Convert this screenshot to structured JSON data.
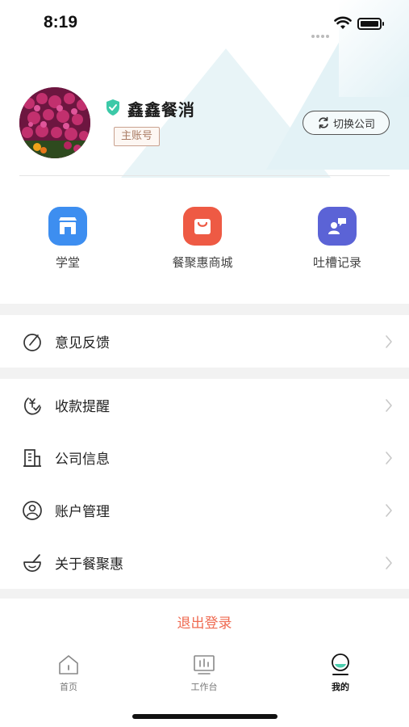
{
  "status_bar": {
    "time": "8:19"
  },
  "profile": {
    "company_name": "鑫鑫餐消",
    "role": "主账号",
    "switch_label": "切换公司"
  },
  "quick_actions": [
    {
      "label": "学堂",
      "icon": "store-icon",
      "color": "#3d8ef0"
    },
    {
      "label": "餐聚惠商城",
      "icon": "shopping-bag-icon",
      "color": "#ee5a44"
    },
    {
      "label": "吐槽记录",
      "icon": "speech-person-icon",
      "color": "#5b63d6"
    }
  ],
  "menu_groups": [
    [
      {
        "label": "意见反馈",
        "icon": "feedback-icon"
      }
    ],
    [
      {
        "label": "收款提醒",
        "icon": "payment-reminder-icon"
      },
      {
        "label": "公司信息",
        "icon": "building-icon"
      },
      {
        "label": "账户管理",
        "icon": "user-circle-icon"
      },
      {
        "label": "关于餐聚惠",
        "icon": "bowl-icon"
      }
    ]
  ],
  "logout_label": "退出登录",
  "tabbar": [
    {
      "label": "首页",
      "icon": "home-icon",
      "active": false
    },
    {
      "label": "工作台",
      "icon": "workbench-icon",
      "active": false
    },
    {
      "label": "我的",
      "icon": "profile-icon",
      "active": true
    }
  ]
}
